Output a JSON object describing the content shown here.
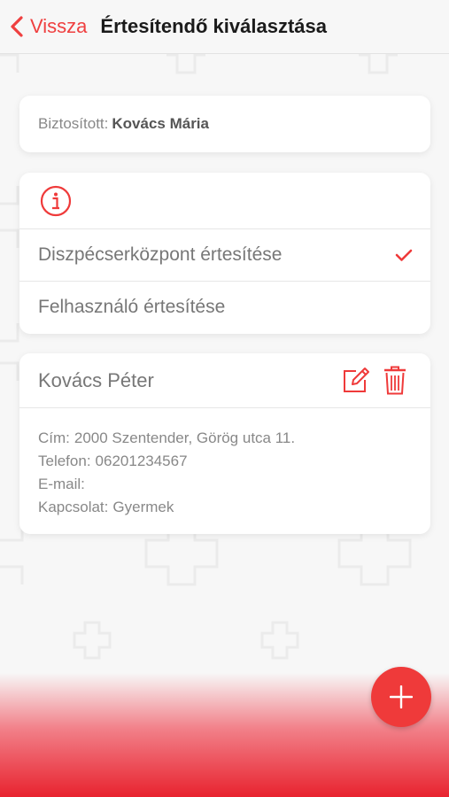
{
  "header": {
    "back_label": "Vissza",
    "title": "Értesítendő kiválasztása"
  },
  "insured": {
    "label": "Biztosított:",
    "name": "Kovács Mária"
  },
  "options": [
    {
      "label": "Diszpécserközpont értesítése",
      "selected": true
    },
    {
      "label": "Felhasználó értesítése",
      "selected": false
    }
  ],
  "contact": {
    "name": "Kovács Péter",
    "details": [
      {
        "label": "Cím:",
        "value": "2000 Szentender, Görög utca 11."
      },
      {
        "label": "Telefon:",
        "value": "06201234567"
      },
      {
        "label": "E-mail:",
        "value": ""
      },
      {
        "label": "Kapcsolat:",
        "value": "Gyermek"
      }
    ]
  },
  "colors": {
    "accent": "#ef3a3a",
    "background": "#f7f7f7"
  },
  "icons": {
    "back": "chevron-left-icon",
    "info": "info-circle-icon",
    "check": "checkmark-icon",
    "edit": "edit-icon",
    "delete": "trash-icon",
    "add": "plus-icon"
  }
}
